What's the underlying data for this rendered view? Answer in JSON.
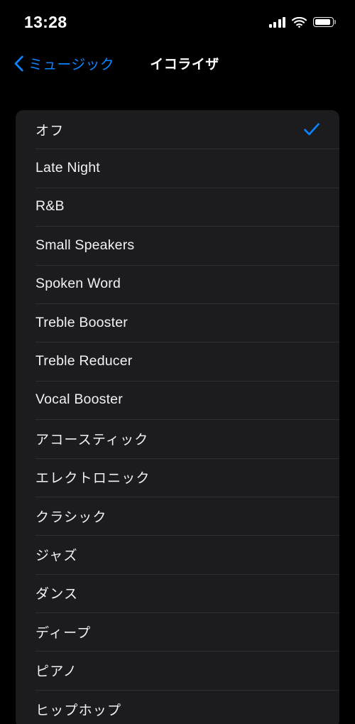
{
  "status_bar": {
    "time": "13:28",
    "cellular_icon": "cellular-signal-icon",
    "cellular_bars": 4,
    "wifi_icon": "wifi-icon",
    "battery_icon": "battery-icon",
    "battery_level_percent": 90
  },
  "nav_bar": {
    "back_label": "ミュージック",
    "back_chevron_icon": "chevron-left-icon",
    "title": "イコライザ"
  },
  "colors": {
    "accent": "#0A84FF",
    "background": "#000000",
    "row_background": "#1C1C1E",
    "separator": "#2E2E30",
    "label": "#F2F2F4"
  },
  "equalizer_list": {
    "selected_index": 0,
    "checkmark_icon": "checkmark-icon",
    "items": [
      {
        "label": "オフ",
        "script": "jp",
        "selected": true
      },
      {
        "label": "Late Night",
        "script": "latin",
        "selected": false
      },
      {
        "label": "R&B",
        "script": "latin",
        "selected": false
      },
      {
        "label": "Small Speakers",
        "script": "latin",
        "selected": false
      },
      {
        "label": "Spoken Word",
        "script": "latin",
        "selected": false
      },
      {
        "label": "Treble Booster",
        "script": "latin",
        "selected": false
      },
      {
        "label": "Treble Reducer",
        "script": "latin",
        "selected": false
      },
      {
        "label": "Vocal Booster",
        "script": "latin",
        "selected": false
      },
      {
        "label": "アコースティック",
        "script": "jp",
        "selected": false
      },
      {
        "label": "エレクトロニック",
        "script": "jp",
        "selected": false
      },
      {
        "label": "クラシック",
        "script": "jp",
        "selected": false
      },
      {
        "label": "ジャズ",
        "script": "jp",
        "selected": false
      },
      {
        "label": "ダンス",
        "script": "jp",
        "selected": false
      },
      {
        "label": "ディープ",
        "script": "jp",
        "selected": false
      },
      {
        "label": "ピアノ",
        "script": "jp",
        "selected": false
      },
      {
        "label": "ヒップホップ",
        "script": "jp",
        "selected": false
      }
    ]
  }
}
